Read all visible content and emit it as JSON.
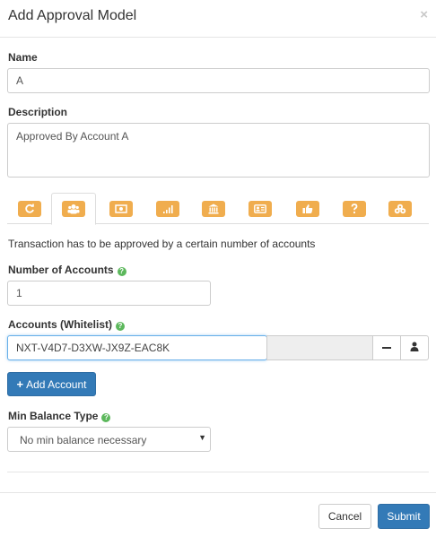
{
  "header": {
    "title": "Add Approval Model",
    "close": "×"
  },
  "name": {
    "label": "Name",
    "value": "A"
  },
  "description": {
    "label": "Description",
    "value": "Approved By Account A"
  },
  "tabs": [
    {
      "icon": "refresh-icon"
    },
    {
      "icon": "users-icon"
    },
    {
      "icon": "money-icon"
    },
    {
      "icon": "signal-icon"
    },
    {
      "icon": "bank-icon"
    },
    {
      "icon": "id-card-icon"
    },
    {
      "icon": "thumbs-up-icon"
    },
    {
      "icon": "question-icon"
    },
    {
      "icon": "coins-icon"
    }
  ],
  "active_tab_description": "Transaction has to be approved by a certain number of accounts",
  "num_accounts": {
    "label": "Number of Accounts",
    "value": "1"
  },
  "whitelist": {
    "label": "Accounts (Whitelist)",
    "value": "NXT-V4D7-D3XW-JX9Z-EAC8K"
  },
  "add_account_label": "Add Account",
  "min_balance": {
    "label": "Min Balance Type",
    "selected": "No min balance necessary"
  },
  "footer": {
    "cancel": "Cancel",
    "submit": "Submit"
  },
  "colors": {
    "accent": "#337ab7",
    "tab_icon": "#f0ad4e",
    "help": "#5cb85c"
  }
}
